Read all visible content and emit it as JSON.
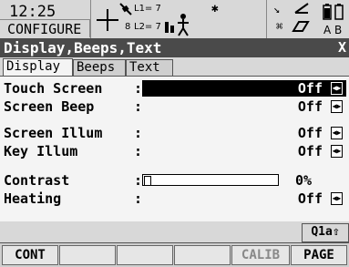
{
  "status": {
    "time": "12:25",
    "mode": "CONFIGURE",
    "l1_count": "L1= 7",
    "l2_count": "L2= 7",
    "sat_count": "8",
    "battery_labels": "A B"
  },
  "window": {
    "title": "Display,Beeps,Text",
    "close_label": "X"
  },
  "tabs": [
    {
      "label": "Display",
      "active": true
    },
    {
      "label": "Beeps",
      "active": false
    },
    {
      "label": "Text",
      "active": false
    }
  ],
  "fields": {
    "touch_screen": {
      "label": "Touch Screen",
      "value": "Off"
    },
    "screen_beep": {
      "label": "Screen Beep",
      "value": "Off"
    },
    "screen_illum": {
      "label": "Screen Illum",
      "value": "Off"
    },
    "key_illum": {
      "label": "Key Illum",
      "value": "Off"
    },
    "contrast": {
      "label": "Contrast",
      "value": "0%"
    },
    "heating": {
      "label": "Heating",
      "value": "Off"
    }
  },
  "colon": ":",
  "page_indicator": "Q1a⇧",
  "fkeys": {
    "f1": "CONT",
    "f2": "",
    "f3": "",
    "f4": "",
    "f5": "CALIB",
    "f6": "PAGE"
  }
}
